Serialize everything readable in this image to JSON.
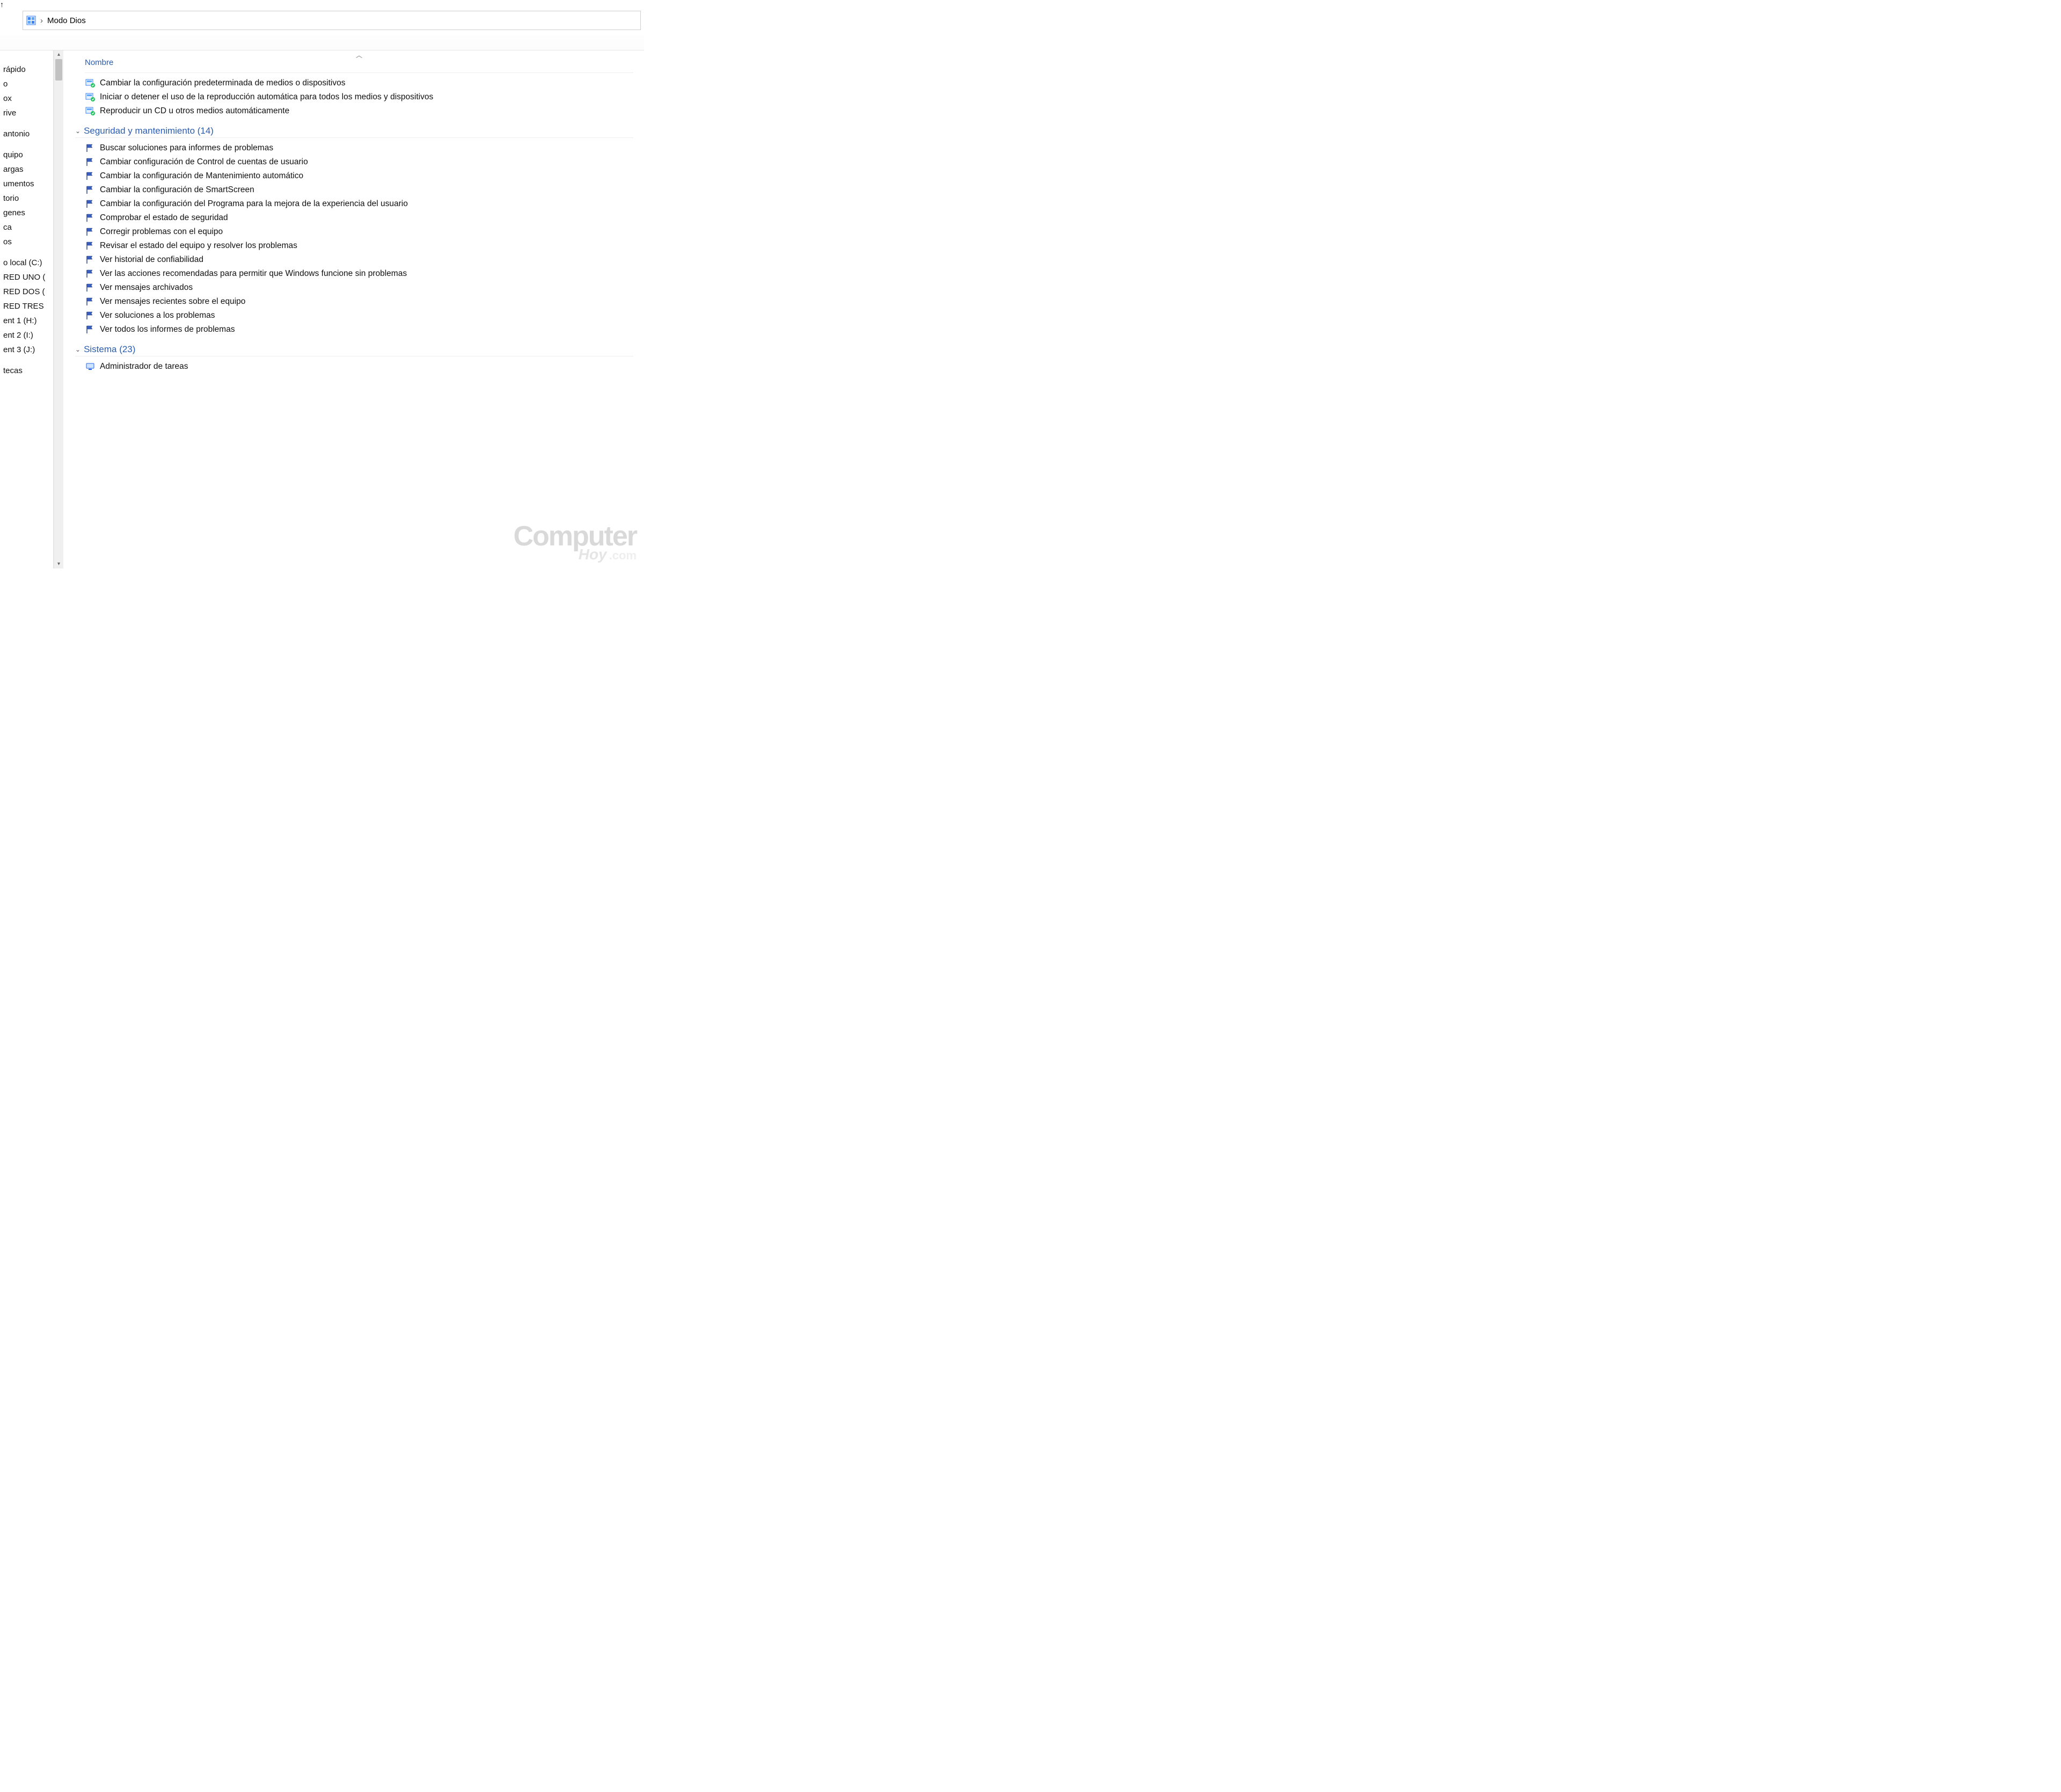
{
  "breadcrumb": {
    "title": "Modo Dios",
    "separator": "›"
  },
  "column_header": "Nombre",
  "sidebar": {
    "items": [
      "rápido",
      "o",
      "ox",
      "rive",
      "antonio",
      "quipo",
      "argas",
      "umentos",
      "torio",
      "genes",
      "ca",
      "os",
      "o local (C:)",
      "RED UNO (",
      "RED DOS (",
      "RED TRES",
      "ent 1 (H:)",
      "ent 2 (I:)",
      "ent 3 (J:)",
      "tecas"
    ]
  },
  "ungrouped": [
    "Cambiar la configuración predeterminada de medios o dispositivos",
    "Iniciar o detener el uso de la reproducción automática para todos los medios y dispositivos",
    "Reproducir un CD u otros medios automáticamente"
  ],
  "groups": [
    {
      "title": "Seguridad y mantenimiento (14)",
      "icon": "flag",
      "items": [
        "Buscar soluciones para informes de problemas",
        "Cambiar configuración de Control de cuentas de usuario",
        "Cambiar la configuración de Mantenimiento automático",
        "Cambiar la configuración de SmartScreen",
        "Cambiar la configuración del Programa para la mejora de la experiencia del usuario",
        "Comprobar el estado de seguridad",
        "Corregir problemas con el equipo",
        "Revisar el estado del equipo y resolver los problemas",
        "Ver historial de confiabilidad",
        "Ver las acciones recomendadas para permitir que Windows funcione sin problemas",
        "Ver mensajes archivados",
        "Ver mensajes recientes sobre el equipo",
        "Ver soluciones a los problemas",
        "Ver todos los informes de problemas"
      ]
    },
    {
      "title": "Sistema (23)",
      "icon": "monitor",
      "items": [
        "Administrador de tareas"
      ]
    }
  ],
  "watermark": {
    "line1": "Computer",
    "line2": "Hoy",
    "suffix": ".com"
  }
}
